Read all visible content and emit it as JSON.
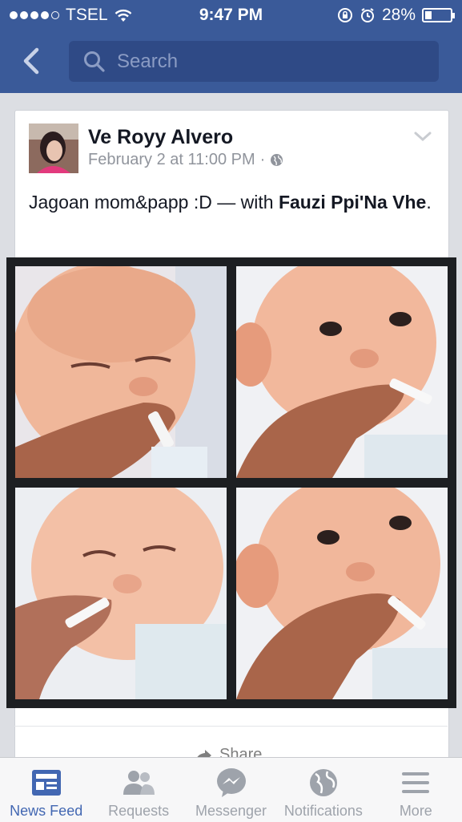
{
  "status_bar": {
    "carrier": "TSEL",
    "time": "9:47 PM",
    "battery": "28%",
    "battery_level": 0.28
  },
  "nav": {
    "search_placeholder": "Search"
  },
  "post": {
    "author": "Ve Royy Alvero",
    "date": "February 2 at 11:00 PM",
    "separator": "·",
    "text_prefix": "Jagoan mom&papp :D",
    "text_with": "— with",
    "tagged": "Fauzi Ppi'Na Vhe",
    "text_suffix": ".",
    "share_label": "Share"
  },
  "tabs": [
    {
      "label": "News Feed",
      "icon": "news-feed-icon",
      "active": true
    },
    {
      "label": "Requests",
      "icon": "friend-requests-icon",
      "active": false
    },
    {
      "label": "Messenger",
      "icon": "messenger-icon",
      "active": false
    },
    {
      "label": "Notifications",
      "icon": "globe-icon",
      "active": false
    },
    {
      "label": "More",
      "icon": "menu-icon",
      "active": false
    }
  ],
  "colors": {
    "brand": "#3a5a99",
    "active_tab": "#4267b2",
    "inactive_tab": "#9ea3ab"
  }
}
